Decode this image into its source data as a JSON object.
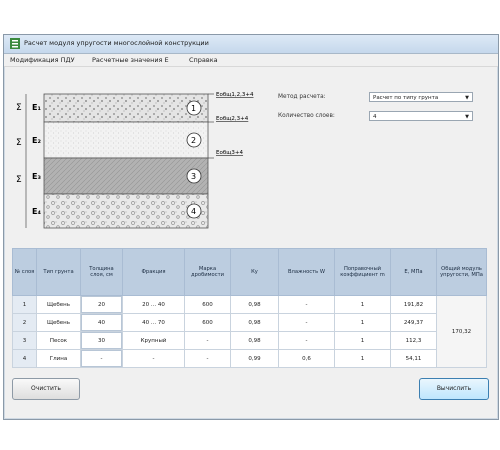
{
  "window": {
    "title": "Расчет модуля упругости многослойной конструкции"
  },
  "menu": [
    "Модификация ПДУ",
    "Расчетные значения Е",
    "Справка"
  ],
  "diagram": {
    "layer_numbers": [
      "1",
      "2",
      "3",
      "4"
    ],
    "layer_labels": [
      "E₁",
      "E₂",
      "E₃",
      "E₄"
    ],
    "side_markers": [
      "Σ",
      "Σ",
      "Σ"
    ],
    "general_modulus_labels": [
      "Eобщ1,2,3+4",
      "Eобщ2,3+4",
      "Eобщ3+4"
    ]
  },
  "form": {
    "method_label": "Метод расчета:",
    "method_value": "Расчет по типу грунта",
    "layers_count_label": "Количество слоев:",
    "layers_count_value": "4"
  },
  "table": {
    "headers": [
      "№ слоя",
      "Тип грунта",
      "Толщина слоя, см",
      "Фракция",
      "Марка дробимости",
      "Ку",
      "Влажность W",
      "Поправочный коэффициент m",
      "E, МПа",
      "Общий модуль упругости, МПа"
    ],
    "rows": [
      [
        "1",
        "Щебень",
        "20",
        "20 ... 40",
        "600",
        "0,98",
        "-",
        "1",
        "191,82"
      ],
      [
        "2",
        "Щебень",
        "40",
        "40 ... 70",
        "600",
        "0,98",
        "-",
        "1",
        "249,37"
      ],
      [
        "3",
        "Песок",
        "30",
        "Крупный",
        "-",
        "0,98",
        "-",
        "1",
        "112,3"
      ],
      [
        "4",
        "Глина",
        "-",
        "-",
        "-",
        "0,99",
        "0,6",
        "1",
        "54,11"
      ]
    ],
    "total_modulus": "170,32"
  },
  "buttons": {
    "clear": "Очистить",
    "compute": "Вычислить"
  },
  "colors": {
    "title_bar": "#c5d8ec",
    "table_header": "#bccde0",
    "primary_button": "#bee6fd"
  }
}
